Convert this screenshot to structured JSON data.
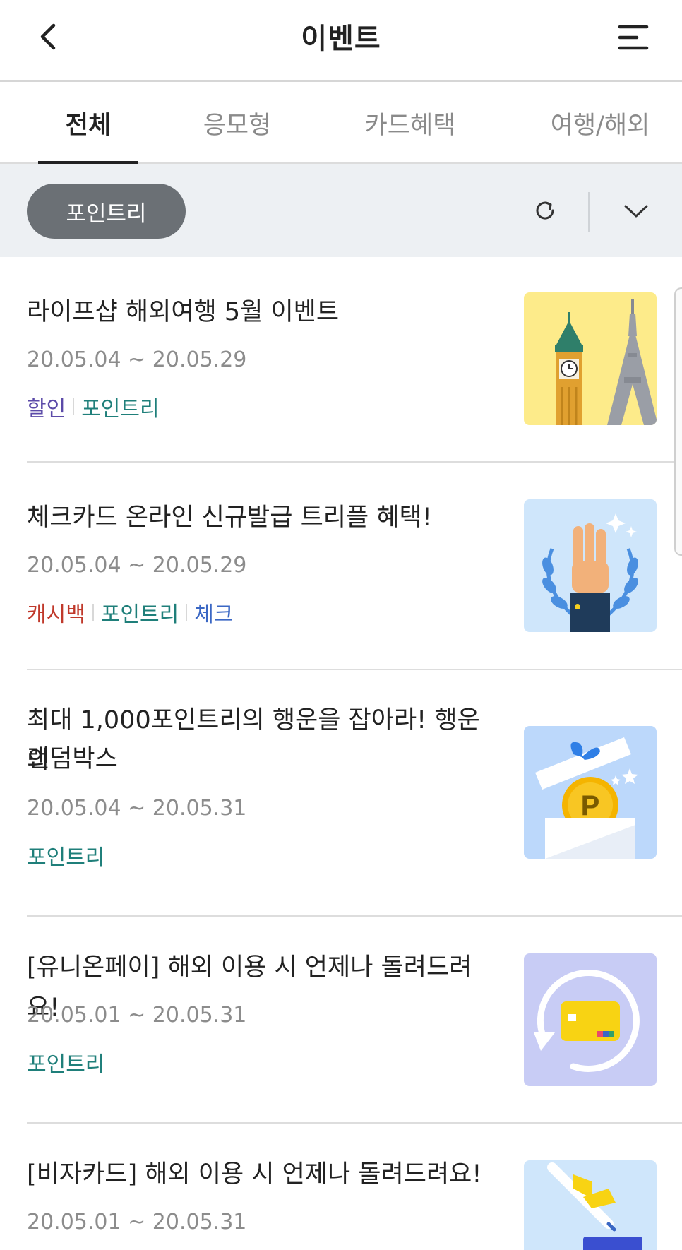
{
  "header": {
    "title": "이벤트",
    "back_icon": "chevron-left-icon",
    "menu_icon": "menu-icon"
  },
  "tabs": [
    {
      "label": "전체",
      "active": true
    },
    {
      "label": "응모형",
      "active": false
    },
    {
      "label": "카드혜택",
      "active": false
    },
    {
      "label": "여행/해외",
      "active": false
    }
  ],
  "filter": {
    "chip_label": "포인트리",
    "refresh_icon": "refresh-icon",
    "expand_icon": "chevron-down-icon"
  },
  "events": [
    {
      "title": "라이프샵 해외여행 5월 이벤트",
      "date": "20.05.04 ~ 20.05.29",
      "tags": [
        "할인",
        "포인트리"
      ],
      "thumbnail": "landmarks-icon"
    },
    {
      "title": "체크카드 온라인 신규발급 트리플 혜택!",
      "date": "20.05.04 ~ 20.05.29",
      "tags": [
        "캐시백",
        "포인트리",
        "체크"
      ],
      "thumbnail": "three-fingers-laurel-icon"
    },
    {
      "title_line1": "최대 1,000포인트리의 행운을 잡아라! 행운의",
      "title_line2": "랜덤박스",
      "date": "20.05.04 ~ 20.05.31",
      "tags": [
        "포인트리"
      ],
      "thumbnail": "gift-box-coin-icon",
      "coin_letter": "P"
    },
    {
      "title": "[유니온페이] 해외 이용 시 언제나 돌려드려요!",
      "date": "20.05.01 ~ 20.05.31",
      "tags": [
        "포인트리"
      ],
      "thumbnail": "card-cycle-icon"
    },
    {
      "title": "[비자카드] 해외 이용 시 언제나 돌려드려요!",
      "date": "20.05.01 ~ 20.05.31",
      "tags": [],
      "thumbnail": "airplane-icon"
    }
  ],
  "colors": {
    "tag_discount": "#5b4aa8",
    "tag_point": "#1f7f7a",
    "tag_cashback": "#c0392b",
    "tag_check": "#3a67c4",
    "chip_bg": "#6b7075",
    "filter_bar_bg": "#edf0f3"
  }
}
